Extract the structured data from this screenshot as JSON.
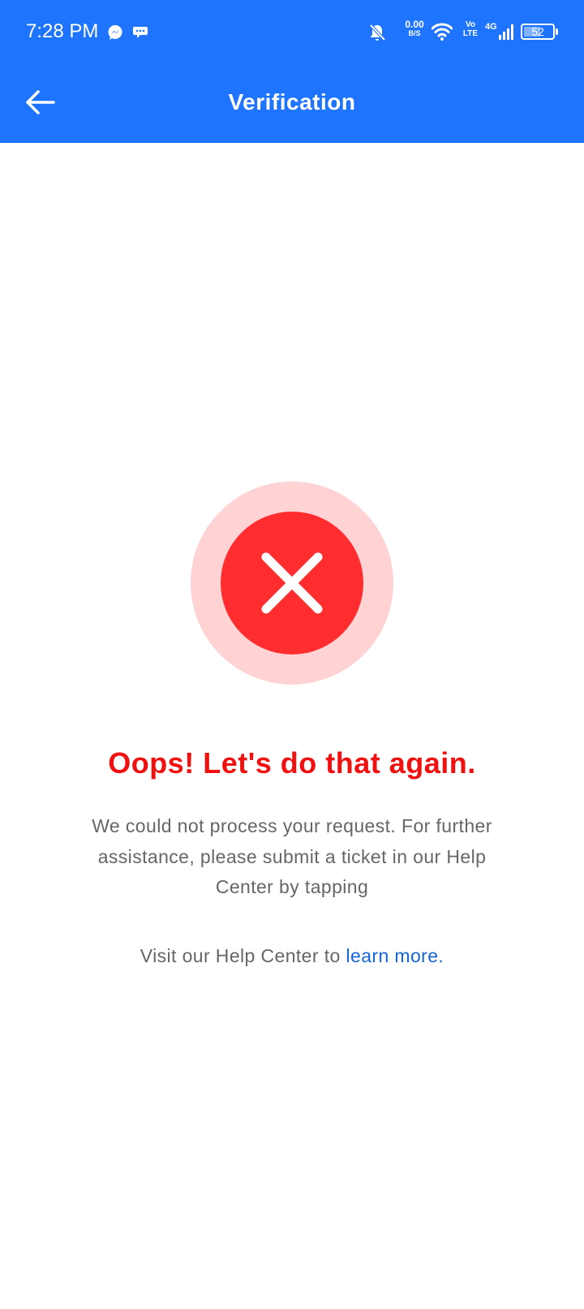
{
  "status_bar": {
    "time": "7:28 PM",
    "notification_icons": [
      "messenger-icon",
      "chat-bubble-icon"
    ],
    "net_speed_value": "0.00",
    "net_speed_unit": "B/S",
    "volte_top": "Vo",
    "volte_bottom": "LTE",
    "network_type": "4G",
    "battery_level": "52"
  },
  "app_bar": {
    "back_icon": "arrow-left-icon",
    "title": "Verification"
  },
  "main": {
    "error_icon": "close-x-icon",
    "title": "Oops! Let's do that again.",
    "message": "We could not process your request. For further assistance, please submit a ticket in our Help Center by tapping",
    "help_prefix": "Visit our Help Center to ",
    "help_link": "learn more."
  },
  "colors": {
    "app_bar_bg": "#1e74fc",
    "error_red": "#f01010",
    "error_circle": "#ff2d30",
    "error_halo": "#ffd3d3",
    "link_blue": "#1565d8",
    "body_text": "#666666"
  }
}
